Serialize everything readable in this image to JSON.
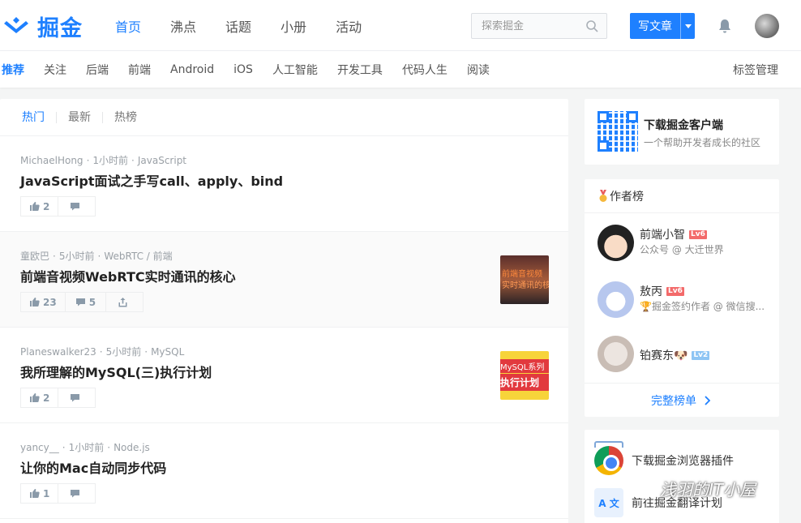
{
  "header": {
    "logo_text": "掘金",
    "nav": [
      {
        "label": "首页",
        "active": true
      },
      {
        "label": "沸点",
        "active": false
      },
      {
        "label": "话题",
        "active": false
      },
      {
        "label": "小册",
        "active": false
      },
      {
        "label": "活动",
        "active": false
      }
    ],
    "search_placeholder": "探索掘金",
    "write_label": "写文章",
    "accent_color": "#1e80ff"
  },
  "subnav": {
    "tags": [
      {
        "label": "推荐",
        "active": true
      },
      {
        "label": "关注",
        "active": false
      },
      {
        "label": "后端",
        "active": false
      },
      {
        "label": "前端",
        "active": false
      },
      {
        "label": "Android",
        "active": false
      },
      {
        "label": "iOS",
        "active": false
      },
      {
        "label": "人工智能",
        "active": false
      },
      {
        "label": "开发工具",
        "active": false
      },
      {
        "label": "代码人生",
        "active": false
      },
      {
        "label": "阅读",
        "active": false
      }
    ],
    "manage_label": "标签管理"
  },
  "feed": {
    "tabs": [
      "热门",
      "最新",
      "热榜"
    ],
    "entries": [
      {
        "author": "MichaelHong",
        "time": "1小时前",
        "tags": "JavaScript",
        "title": "JavaScript面试之手写call、apply、bind",
        "likes": "2",
        "comments": "",
        "thumb": "none"
      },
      {
        "author": "童欧巴",
        "time": "5小时前",
        "tags": "WebRTC / 前端",
        "title": "前端音视频WebRTC实时通讯的核心",
        "likes": "23",
        "comments": "5",
        "thumb": "a",
        "thumb_line1": "前端音视频",
        "thumb_line2": "实时通讯的核心"
      },
      {
        "author": "Planeswalker23",
        "time": "5小时前",
        "tags": "MySQL",
        "title": "我所理解的MySQL(三)执行计划",
        "likes": "2",
        "comments": "",
        "thumb": "b",
        "thumb_line1": "MySQL系列",
        "thumb_line2": "执行计划"
      },
      {
        "author": "yancy__",
        "time": "1小时前",
        "tags": "Node.js",
        "title": "让你的Mac自动同步代码",
        "likes": "1",
        "comments": "",
        "thumb": "none"
      }
    ]
  },
  "sidebar": {
    "download": {
      "title": "下载掘金客户端",
      "subtitle": "一个帮助开发者成长的社区"
    },
    "authors": {
      "heading": "作者榜",
      "list": [
        {
          "name": "前端小智",
          "level": "Lv6",
          "level_color": "red",
          "desc": "公众号 @ 大迁世界"
        },
        {
          "name": "敖丙",
          "level": "Lv6",
          "level_color": "red",
          "desc": "🏆掘金签约作者 @ 微信搜..."
        },
        {
          "name": "铂赛东🐶",
          "level": "Lv2",
          "level_color": "blue",
          "desc": ""
        }
      ],
      "footer": "完整榜单"
    },
    "extensions": [
      {
        "label": "下载掘金浏览器插件"
      },
      {
        "label": "前往掘金翻译计划",
        "icon_text": "A 文"
      }
    ]
  },
  "watermark": "浅羽的IT小屋"
}
